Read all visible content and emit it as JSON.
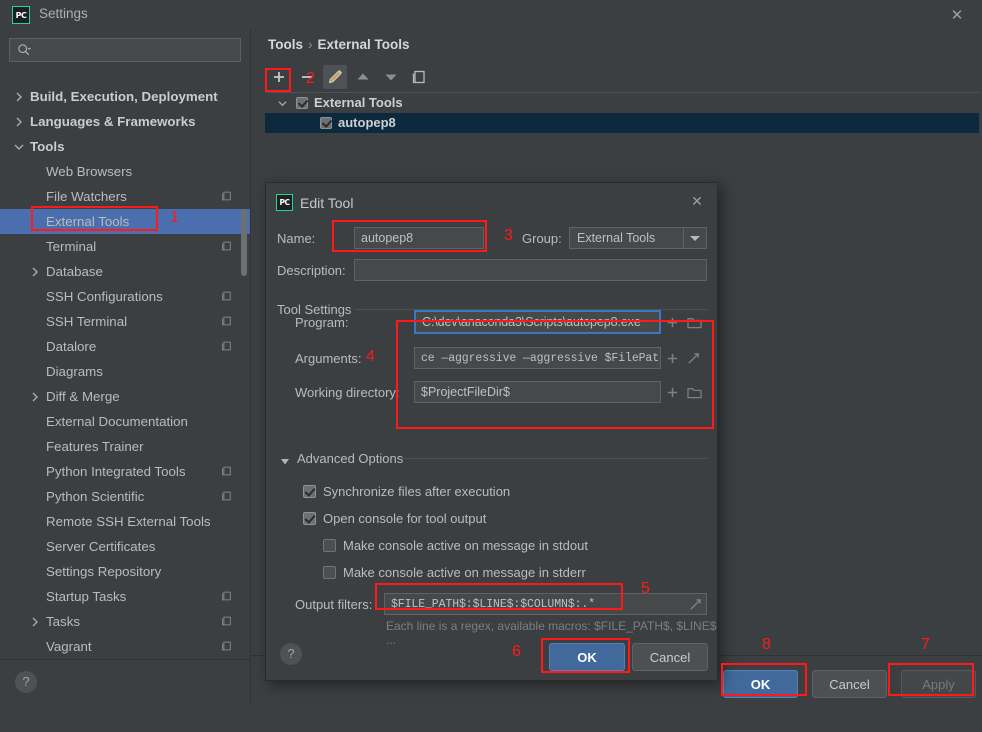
{
  "window": {
    "title": "Settings",
    "logo_text": "PC",
    "close_icon": "✕"
  },
  "sidebar": {
    "search": {
      "value": "",
      "placeholder": ""
    },
    "items": [
      {
        "label": "Build, Execution, Deployment",
        "indent": 1,
        "arrow": "right",
        "bold": true,
        "copy": false,
        "selected": false
      },
      {
        "label": "Languages & Frameworks",
        "indent": 1,
        "arrow": "right",
        "bold": true,
        "copy": false,
        "selected": false
      },
      {
        "label": "Tools",
        "indent": 1,
        "arrow": "down",
        "bold": true,
        "copy": false,
        "selected": false
      },
      {
        "label": "Web Browsers",
        "indent": 2,
        "arrow": "",
        "bold": false,
        "copy": false,
        "selected": false
      },
      {
        "label": "File Watchers",
        "indent": 2,
        "arrow": "",
        "bold": false,
        "copy": true,
        "selected": false
      },
      {
        "label": "External Tools",
        "indent": 2,
        "arrow": "",
        "bold": false,
        "copy": false,
        "selected": true
      },
      {
        "label": "Terminal",
        "indent": 2,
        "arrow": "",
        "bold": false,
        "copy": true,
        "selected": false
      },
      {
        "label": "Database",
        "indent": 2,
        "arrow": "right",
        "bold": false,
        "copy": false,
        "selected": false
      },
      {
        "label": "SSH Configurations",
        "indent": 2,
        "arrow": "",
        "bold": false,
        "copy": true,
        "selected": false
      },
      {
        "label": "SSH Terminal",
        "indent": 2,
        "arrow": "",
        "bold": false,
        "copy": true,
        "selected": false
      },
      {
        "label": "Datalore",
        "indent": 2,
        "arrow": "",
        "bold": false,
        "copy": true,
        "selected": false
      },
      {
        "label": "Diagrams",
        "indent": 2,
        "arrow": "",
        "bold": false,
        "copy": false,
        "selected": false
      },
      {
        "label": "Diff & Merge",
        "indent": 2,
        "arrow": "right",
        "bold": false,
        "copy": false,
        "selected": false
      },
      {
        "label": "External Documentation",
        "indent": 2,
        "arrow": "",
        "bold": false,
        "copy": false,
        "selected": false
      },
      {
        "label": "Features Trainer",
        "indent": 2,
        "arrow": "",
        "bold": false,
        "copy": false,
        "selected": false
      },
      {
        "label": "Python Integrated Tools",
        "indent": 2,
        "arrow": "",
        "bold": false,
        "copy": true,
        "selected": false
      },
      {
        "label": "Python Scientific",
        "indent": 2,
        "arrow": "",
        "bold": false,
        "copy": true,
        "selected": false
      },
      {
        "label": "Remote SSH External Tools",
        "indent": 2,
        "arrow": "",
        "bold": false,
        "copy": false,
        "selected": false
      },
      {
        "label": "Server Certificates",
        "indent": 2,
        "arrow": "",
        "bold": false,
        "copy": false,
        "selected": false
      },
      {
        "label": "Settings Repository",
        "indent": 2,
        "arrow": "",
        "bold": false,
        "copy": false,
        "selected": false
      },
      {
        "label": "Startup Tasks",
        "indent": 2,
        "arrow": "",
        "bold": false,
        "copy": true,
        "selected": false
      },
      {
        "label": "Tasks",
        "indent": 2,
        "arrow": "right",
        "bold": false,
        "copy": true,
        "selected": false
      },
      {
        "label": "Vagrant",
        "indent": 2,
        "arrow": "",
        "bold": false,
        "copy": true,
        "selected": false
      }
    ],
    "help_label": "?"
  },
  "main": {
    "breadcrumb": {
      "parent": "Tools",
      "separator": "›",
      "current": "External Tools"
    },
    "toolbar": {
      "add_label": "+",
      "remove_label": "–",
      "edit_label": "edit-pencil-icon",
      "up_label": "move-up-icon",
      "down_label": "move-down-icon",
      "copy_label": "copy-icon"
    },
    "tool_tree": [
      {
        "label": "External Tools",
        "checked": true,
        "indent": 0,
        "selected": false,
        "expanded": true
      },
      {
        "label": "autopep8",
        "checked": true,
        "indent": 1,
        "selected": true,
        "expanded": false
      }
    ],
    "buttons": {
      "ok": "OK",
      "cancel": "Cancel",
      "apply": "Apply"
    }
  },
  "dialog": {
    "title": "Edit Tool",
    "logo_text": "PC",
    "close_icon": "✕",
    "name_label": "Name:",
    "name_value": "autopep8",
    "group_label": "Group:",
    "group_value": "External Tools",
    "description_label": "Description:",
    "description_value": "",
    "tool_settings_label": "Tool Settings",
    "program_label": "Program:",
    "program_value": "C:\\dev\\anaconda3\\Scripts\\autopep8.exe",
    "arguments_label": "Arguments:",
    "arguments_value": "ce —aggressive —aggressive $FilePath$",
    "working_dir_label": "Working directory:",
    "working_dir_value": "$ProjectFileDir$",
    "advanced_options_label": "Advanced Options",
    "checkboxes": [
      {
        "label": "Synchronize files after execution",
        "checked": true,
        "indent": 0
      },
      {
        "label": "Open console for tool output",
        "checked": true,
        "indent": 0
      },
      {
        "label": "Make console active on message in stdout",
        "checked": false,
        "indent": 1
      },
      {
        "label": "Make console active on message in stderr",
        "checked": false,
        "indent": 1
      }
    ],
    "output_filters_label": "Output filters:",
    "output_filters_value": "$FILE_PATH$:$LINE$:$COLUMN$:.*",
    "output_hint": "Each line is a regex, available macros: $FILE_PATH$, $LINE$ ...",
    "ok_label": "OK",
    "cancel_label": "Cancel",
    "help_label": "?"
  },
  "annotations": {
    "color": "#ff1a1a",
    "numbers": [
      "1",
      "2",
      "3",
      "4",
      "5",
      "6",
      "7",
      "8"
    ]
  }
}
